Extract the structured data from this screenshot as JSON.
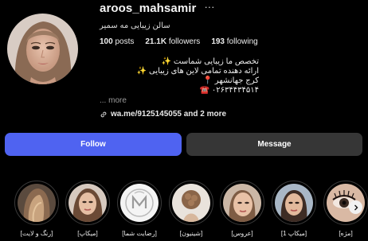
{
  "profile": {
    "username": "aroos_mahsamir",
    "more_icon": "ellipsis-icon",
    "subtitle": "سالن زیبایی مه سمیر",
    "stats": {
      "posts_count": "100",
      "posts_label": "posts",
      "followers_count": "21.1K",
      "followers_label": "followers",
      "following_count": "193",
      "following_label": "following"
    },
    "bio": [
      "تخصص ما زیبایی شماست ✨",
      "ارائه دهنده تمامی لاین های زیبایی ✨",
      "کرج جهانشهر 📍",
      "۰۲۶۳۴۴۳۴۵۱۴ ☎️"
    ],
    "bio_more": "... more",
    "link_text": "wa.me/9125145055 and 2 more",
    "link_icon": "link-icon"
  },
  "actions": {
    "follow_label": "Follow",
    "message_label": "Message"
  },
  "highlights": [
    {
      "label": "[رنگ و لایت]"
    },
    {
      "label": "[میکاپ]"
    },
    {
      "label": "[رضایت شما]"
    },
    {
      "label": "[شینیون]"
    },
    {
      "label": "[عروس]"
    },
    {
      "label": "[میکاپ 1]"
    },
    {
      "label": "[مژه]"
    }
  ],
  "colors": {
    "background": "#000000",
    "follow_button": "#4f63f1",
    "message_button": "#363636",
    "muted_text": "#9a9a9a"
  }
}
